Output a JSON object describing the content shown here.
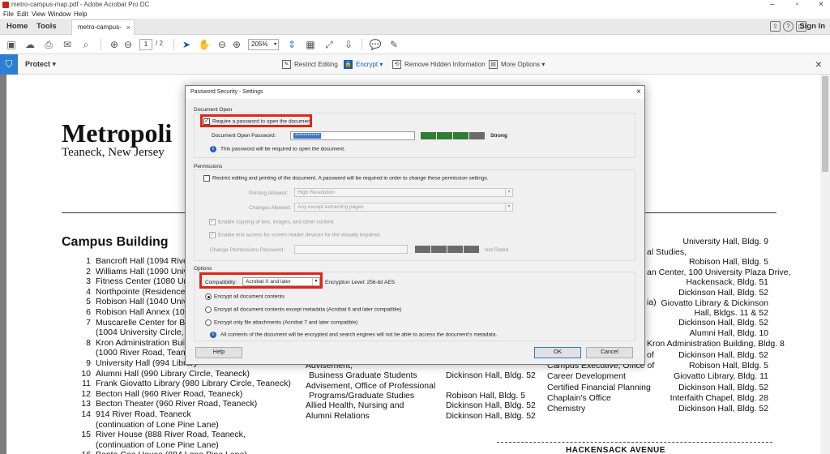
{
  "window": {
    "title": "metro-campus-map.pdf - Adobe Acrobat Pro DC",
    "menu": [
      "File",
      "Edit",
      "View",
      "Window",
      "Help"
    ]
  },
  "tabs": {
    "home": "Home",
    "tools": "Tools",
    "document": "metro-campus-ma...",
    "sign_in": "Sign In"
  },
  "toolbar": {
    "page_current": "1",
    "page_total": "/ 2",
    "zoom": "205%"
  },
  "protect_bar": {
    "label": "Protect",
    "restrict_editing": "Restrict Editing",
    "encrypt": "Encrypt",
    "remove_hidden": "Remove Hidden Information",
    "more_options": "More Options"
  },
  "page": {
    "title": "Metropoli",
    "subtitle": "Teaneck, New Jersey",
    "heading": "Campus Building",
    "buildings": [
      {
        "num": "1",
        "text": "Bancroft Hall (1094 River R"
      },
      {
        "num": "2",
        "text": "Williams Hall (1090 Univers"
      },
      {
        "num": "3",
        "text": "Fitness Center (1080 Unive"
      },
      {
        "num": "4",
        "text": "Northpointe (Residence Hal"
      },
      {
        "num": "5",
        "text": "Robison Hall (1040 Universi"
      },
      {
        "num": "6",
        "text": "Robison Hall Annex (1081 S"
      },
      {
        "num": "7",
        "text": "Muscarelle Center for Buildi"
      },
      {
        "num": "",
        "text": "(1004 University Circle, Tea"
      },
      {
        "num": "8",
        "text": "Kron Administration Building"
      },
      {
        "num": "",
        "text": "(1000 River Road, Teaneck)"
      },
      {
        "num": "9",
        "text": "University Hall (994 Library"
      },
      {
        "num": "10",
        "text": "Alumni Hall (990 Library Circle, Teaneck)"
      },
      {
        "num": "11",
        "text": "Frank Giovatto Library (980 Library Circle, Teaneck)"
      },
      {
        "num": "12",
        "text": "Becton Hall (960 River Road, Teaneck)"
      },
      {
        "num": "13",
        "text": "Becton Theater (960 River Road, Teaneck)"
      },
      {
        "num": "14",
        "text": "914 River Road, Teaneck"
      },
      {
        "num": "",
        "text": "(continuation of Lone Pine Lane)"
      },
      {
        "num": "15",
        "text": "River House (888 River Road, Teaneck,"
      },
      {
        "num": "",
        "text": "(continuation of Lone Pine Lane)"
      },
      {
        "num": "16",
        "text": "Banta Coe House (884 Lone Pine Lane)"
      }
    ],
    "middle_col": [
      {
        "left": "Advisement,",
        "right": ""
      },
      {
        "left": "Business Graduate Students",
        "right": "Dickinson Hall, Bldg. 52"
      },
      {
        "left": "Advisement, Office of Professional",
        "right": ""
      },
      {
        "left": "Programs/Graduate Studies",
        "right": "Robison Hall, Bldg. 5"
      },
      {
        "left": "Allied Health, Nursing and",
        "right": "Dickinson Hall, Bldg. 52"
      },
      {
        "left": "Alumni Relations",
        "right": "Dickinson Hall, Bldg. 52"
      }
    ],
    "right_partial": [
      "al Studies,",
      "an Center, 100 University Plaza Drive,",
      "ia)",
      "Kron Administration Building, Bldg. 8",
      "of",
      "Campus Executive, Office of",
      "Career Development",
      "Certified Financial Planning",
      "Chaplain's Office",
      "Chemistry"
    ],
    "right_col": [
      "University Hall, Bldg. 9",
      "Robison Hall, Bldg. 5",
      "Hackensack, Bldg. 51",
      "Dickinson Hall, Bldg. 52",
      "Giovatto Library & Dickinson",
      "Hall, Bldgs. 11 & 52",
      "Dickinson Hall, Bldg. 52",
      "Alumni Hall, Bldg. 10",
      "Dickinson Hall, Bldg. 52",
      "Robison Hall, Bldg. 5",
      "Giovatto Library, Bldg. 11",
      "Dickinson Hall, Bldg. 52",
      "Interfaith Chapel, Bldg. 28",
      "Dickinson Hall, Bldg. 52"
    ],
    "street": "HACKENSACK AVENUE"
  },
  "dialog": {
    "title": "Password Security - Settings",
    "doc_open_label": "Document Open",
    "require_password": "Require a password to open the document",
    "open_password_label": "Document Open Password:",
    "open_password_value": "************",
    "strength": "Strong",
    "password_note": "This password will be required to open the document.",
    "permissions_label": "Permissions",
    "restrict_editing": "Restrict editing and printing of the document. A password will be required in order to change these permission settings.",
    "printing_label": "Printing Allowed:",
    "printing_value": "High Resolution",
    "changes_label": "Changes Allowed:",
    "changes_value": "Any except extracting pages",
    "enable_copying": "Enable copying of text, images, and other content",
    "enable_screen_reader": "Enable text access for screen reader devices for the visually impaired",
    "change_perm_label": "Change Permissions Password:",
    "not_rated": "Not Rated",
    "options_label": "Options",
    "compat_label": "Compatibility:",
    "compat_value": "Acrobat X and later",
    "encryption_level": "Encryption  Level:   256-bit AES",
    "encrypt_all": "Encrypt all document contents",
    "encrypt_except_meta": "Encrypt all document contents except metadata (Acrobat 6 and later compatible)",
    "encrypt_attachments": "Encrypt only file attachments (Acrobat 7 and later compatible)",
    "options_note": "All contents of the document will be encrypted and search engines will not be able to access the document's metadata.",
    "help": "Help",
    "ok": "OK",
    "cancel": "Cancel"
  },
  "colors": {
    "accent": "#2d7dd2",
    "highlight": "#e1251b",
    "strength_on": "#2e7d32",
    "strength_off": "#6b6b6b"
  }
}
